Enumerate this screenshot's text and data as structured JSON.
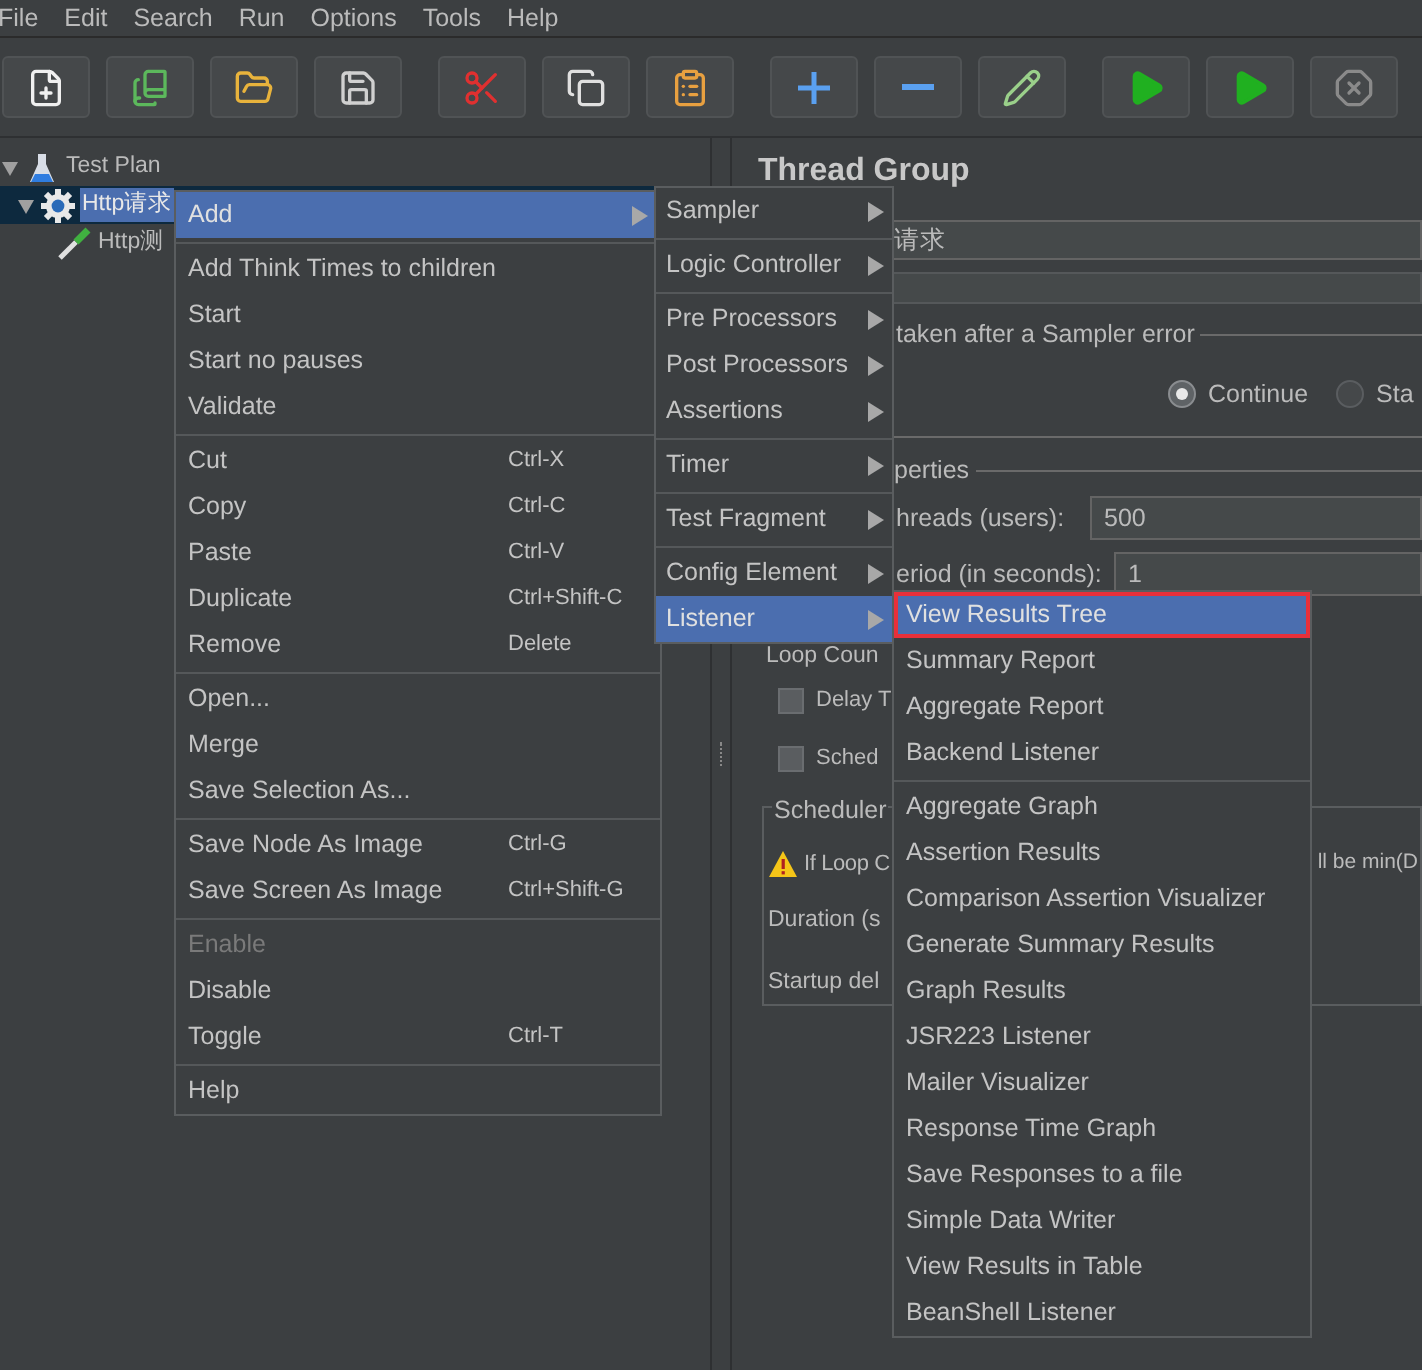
{
  "menu_bar": [
    "File",
    "Edit",
    "Search",
    "Run",
    "Options",
    "Tools",
    "Help"
  ],
  "tree": [
    {
      "label": "Test Plan",
      "kind": "plan",
      "expanded": true,
      "selected": false,
      "children": [
        {
          "label": "Http请求",
          "kind": "thread_group",
          "expanded": true,
          "selected": true,
          "children": [
            {
              "label": "Http测",
              "kind": "sampler",
              "selected": false
            }
          ]
        }
      ]
    }
  ],
  "editor": {
    "title": "Thread Group",
    "name_value": "请求",
    "error_group_label": "taken after a Sampler error",
    "error_actions": [
      {
        "label": "Continue",
        "selected": true
      },
      {
        "label": "Sta",
        "selected": false
      }
    ],
    "properties_label": "perties",
    "fields": [
      {
        "label": "hreads (users):",
        "value": "500"
      },
      {
        "label": "eriod (in seconds):",
        "value": "1"
      }
    ],
    "loop_label": "Loop Coun",
    "checkboxes": [
      {
        "label": "Delay T",
        "checked": false
      },
      {
        "label": "Sched",
        "checked": false
      }
    ],
    "scheduler": {
      "title": "Scheduler",
      "warning": "If Loop C",
      "warning_tail": "ll be min(D",
      "labels": [
        "Duration (s",
        "Startup del"
      ]
    }
  },
  "context_menu": [
    [
      {
        "label": "Add",
        "submenu": true,
        "selected": true,
        "disabled": false
      }
    ],
    [
      {
        "label": "Add Think Times to children",
        "submenu": false,
        "selected": false,
        "disabled": false
      },
      {
        "label": "Start",
        "submenu": false,
        "selected": false,
        "disabled": false
      },
      {
        "label": "Start no pauses",
        "submenu": false,
        "selected": false,
        "disabled": false
      },
      {
        "label": "Validate",
        "submenu": false,
        "selected": false,
        "disabled": false
      }
    ],
    [
      {
        "label": "Cut",
        "shortcut": "Ctrl-X",
        "submenu": false,
        "selected": false,
        "disabled": false
      },
      {
        "label": "Copy",
        "shortcut": "Ctrl-C",
        "submenu": false,
        "selected": false,
        "disabled": false
      },
      {
        "label": "Paste",
        "shortcut": "Ctrl-V",
        "submenu": false,
        "selected": false,
        "disabled": false
      },
      {
        "label": "Duplicate",
        "shortcut": "Ctrl+Shift-C",
        "submenu": false,
        "selected": false,
        "disabled": false
      },
      {
        "label": "Remove",
        "shortcut": "Delete",
        "submenu": false,
        "selected": false,
        "disabled": false
      }
    ],
    [
      {
        "label": "Open...",
        "submenu": false,
        "selected": false,
        "disabled": false
      },
      {
        "label": "Merge",
        "submenu": false,
        "selected": false,
        "disabled": false
      },
      {
        "label": "Save Selection As...",
        "submenu": false,
        "selected": false,
        "disabled": false
      }
    ],
    [
      {
        "label": "Save Node As Image",
        "shortcut": "Ctrl-G",
        "submenu": false,
        "selected": false,
        "disabled": false
      },
      {
        "label": "Save Screen As Image",
        "shortcut": "Ctrl+Shift-G",
        "submenu": false,
        "selected": false,
        "disabled": false
      }
    ],
    [
      {
        "label": "Enable",
        "submenu": false,
        "selected": false,
        "disabled": true
      },
      {
        "label": "Disable",
        "submenu": false,
        "selected": false,
        "disabled": false
      },
      {
        "label": "Toggle",
        "shortcut": "Ctrl-T",
        "submenu": false,
        "selected": false,
        "disabled": false
      }
    ],
    [
      {
        "label": "Help",
        "submenu": false,
        "selected": false,
        "disabled": false
      }
    ]
  ],
  "add_submenu": [
    [
      {
        "label": "Sampler",
        "selected": false
      }
    ],
    [
      {
        "label": "Logic Controller",
        "selected": false
      }
    ],
    [
      {
        "label": "Pre Processors",
        "selected": false
      },
      {
        "label": "Post Processors",
        "selected": false
      },
      {
        "label": "Assertions",
        "selected": false
      }
    ],
    [
      {
        "label": "Timer",
        "selected": false
      }
    ],
    [
      {
        "label": "Test Fragment",
        "selected": false
      }
    ],
    [
      {
        "label": "Config Element",
        "selected": false
      },
      {
        "label": "Listener",
        "selected": true
      }
    ]
  ],
  "listener_submenu": [
    [
      {
        "label": "View Results Tree",
        "selected": true,
        "outlined": true
      },
      {
        "label": "Summary Report",
        "selected": false,
        "outlined": false
      },
      {
        "label": "Aggregate Report",
        "selected": false,
        "outlined": false
      },
      {
        "label": "Backend Listener",
        "selected": false,
        "outlined": false
      }
    ],
    [
      {
        "label": "Aggregate Graph",
        "selected": false,
        "outlined": false
      },
      {
        "label": "Assertion Results",
        "selected": false,
        "outlined": false
      },
      {
        "label": "Comparison Assertion Visualizer",
        "selected": false,
        "outlined": false
      },
      {
        "label": "Generate Summary Results",
        "selected": false,
        "outlined": false
      },
      {
        "label": "Graph Results",
        "selected": false,
        "outlined": false
      },
      {
        "label": "JSR223 Listener",
        "selected": false,
        "outlined": false
      },
      {
        "label": "Mailer Visualizer",
        "selected": false,
        "outlined": false
      },
      {
        "label": "Response Time Graph",
        "selected": false,
        "outlined": false
      },
      {
        "label": "Save Responses to a file",
        "selected": false,
        "outlined": false
      },
      {
        "label": "Simple Data Writer",
        "selected": false,
        "outlined": false
      },
      {
        "label": "View Results in Table",
        "selected": false,
        "outlined": false
      },
      {
        "label": "BeanShell Listener",
        "selected": false,
        "outlined": false
      }
    ]
  ]
}
